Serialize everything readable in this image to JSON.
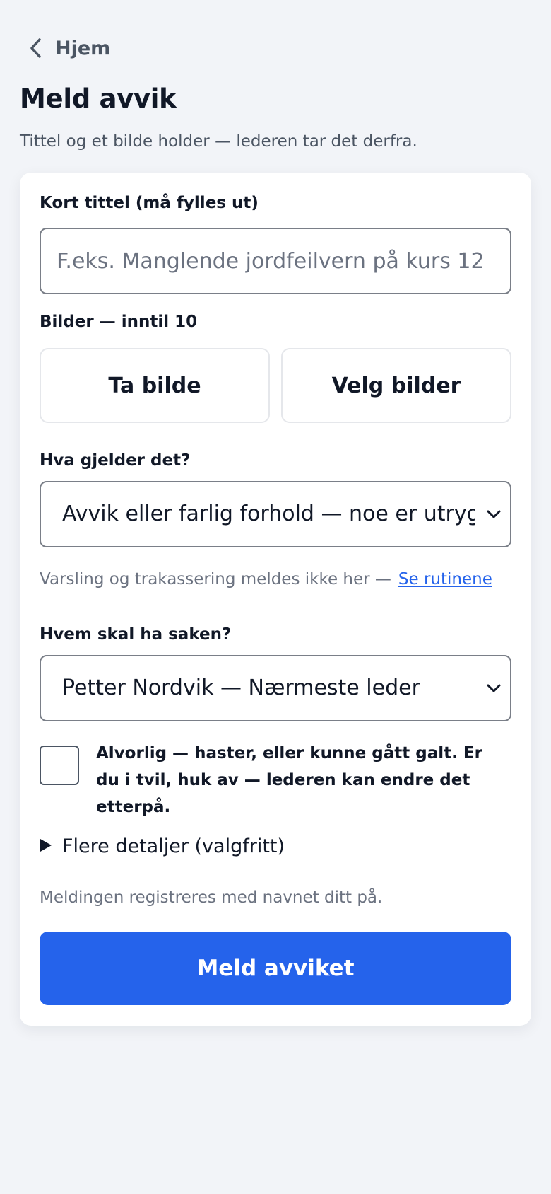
{
  "nav": {
    "back_label": "Hjem"
  },
  "page": {
    "title": "Meld avvik",
    "subtitle": "Tittel og et bilde holder — lederen tar det derfra."
  },
  "form": {
    "title_field": {
      "label": "Kort tittel (må fylles ut)",
      "placeholder": "F.eks. Manglende jordfeilvern på kurs 12",
      "value": ""
    },
    "photos": {
      "label": "Bilder — inntil 10",
      "take_photo": "Ta bilde",
      "choose_photos": "Velg bilder"
    },
    "category": {
      "label": "Hva gjelder det?",
      "selected": "Avvik eller farlig forhold — noe er utrygt"
    },
    "hint": {
      "text": "Varsling og trakassering meldes ikke her —",
      "link": "Se rutinene"
    },
    "assignee": {
      "label": "Hvem skal ha saken?",
      "selected": "Petter Nordvik — Nærmeste leder"
    },
    "serious": {
      "checked": false,
      "label": "Alvorlig — haster, eller kunne gått galt. Er du i tvil, huk av — lederen kan endre det etterpå."
    },
    "more_details": "Flere detaljer (valgfritt)",
    "note": "Meldingen registreres med navnet ditt på.",
    "submit": "Meld avviket"
  },
  "colors": {
    "background": "#f2f4f8",
    "card": "#ffffff",
    "primary": "#2563eb",
    "text": "#111827",
    "muted": "#6b7280"
  },
  "icons": {
    "back": "chevron-left-icon",
    "select": "chevron-down-icon",
    "details": "triangle-right-icon"
  }
}
